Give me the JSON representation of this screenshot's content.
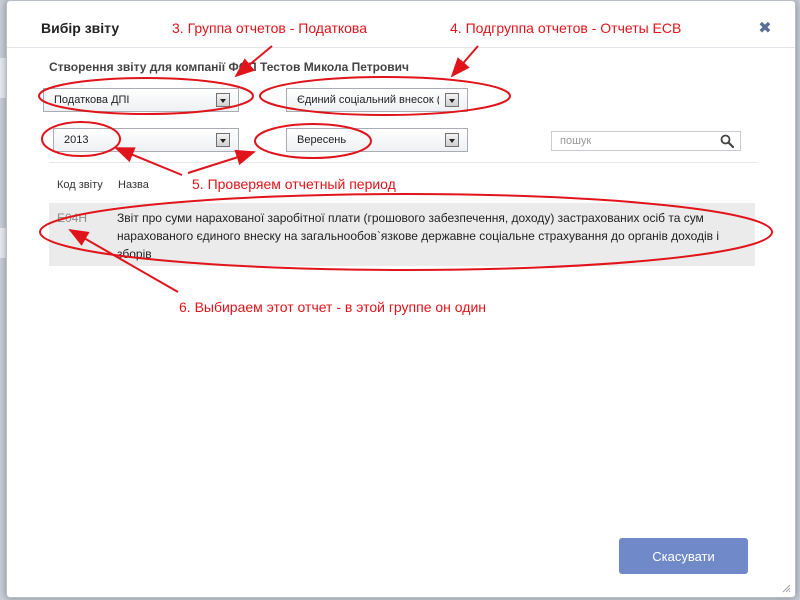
{
  "dialog": {
    "title": "Вибір звіту",
    "close_glyph": "✖",
    "subtitle": "Створення звіту для компанії ФОП Тестов Микола Петрович"
  },
  "filters": {
    "group": {
      "value": "Податкова ДПІ"
    },
    "subgroup": {
      "value": "Єдиний соціальний внесок (Є"
    },
    "year": {
      "value": "2013"
    },
    "period": {
      "value": "Вересень"
    },
    "search": {
      "placeholder": "пошук",
      "value": ""
    }
  },
  "table": {
    "columns": {
      "code": "Код звіту",
      "name": "Назва"
    },
    "rows": [
      {
        "code": "E04H",
        "name": "Звіт про суми нарахованої заробітної плати (грошового забезпечення, доходу) застрахованих осіб та сум нарахованого єдиного внеску на загальнообов`язкове державне соціальне страхування до органів доходів і зборів"
      }
    ]
  },
  "footer": {
    "cancel_label": "Скасувати"
  },
  "annotations": [
    {
      "text": "3. Группа отчетов - Податкова"
    },
    {
      "text": "4. Подгруппа отчетов - Отчеты ЕСВ"
    },
    {
      "text": "5. Проверяем отчетный период"
    },
    {
      "text": "6. Выбираем этот отчет - в этой группе он один"
    }
  ],
  "colors": {
    "annotation": "#e0141b",
    "accent_button": "#6f89c9",
    "close_icon": "#5b6f95",
    "row_background": "#ebebeb"
  }
}
